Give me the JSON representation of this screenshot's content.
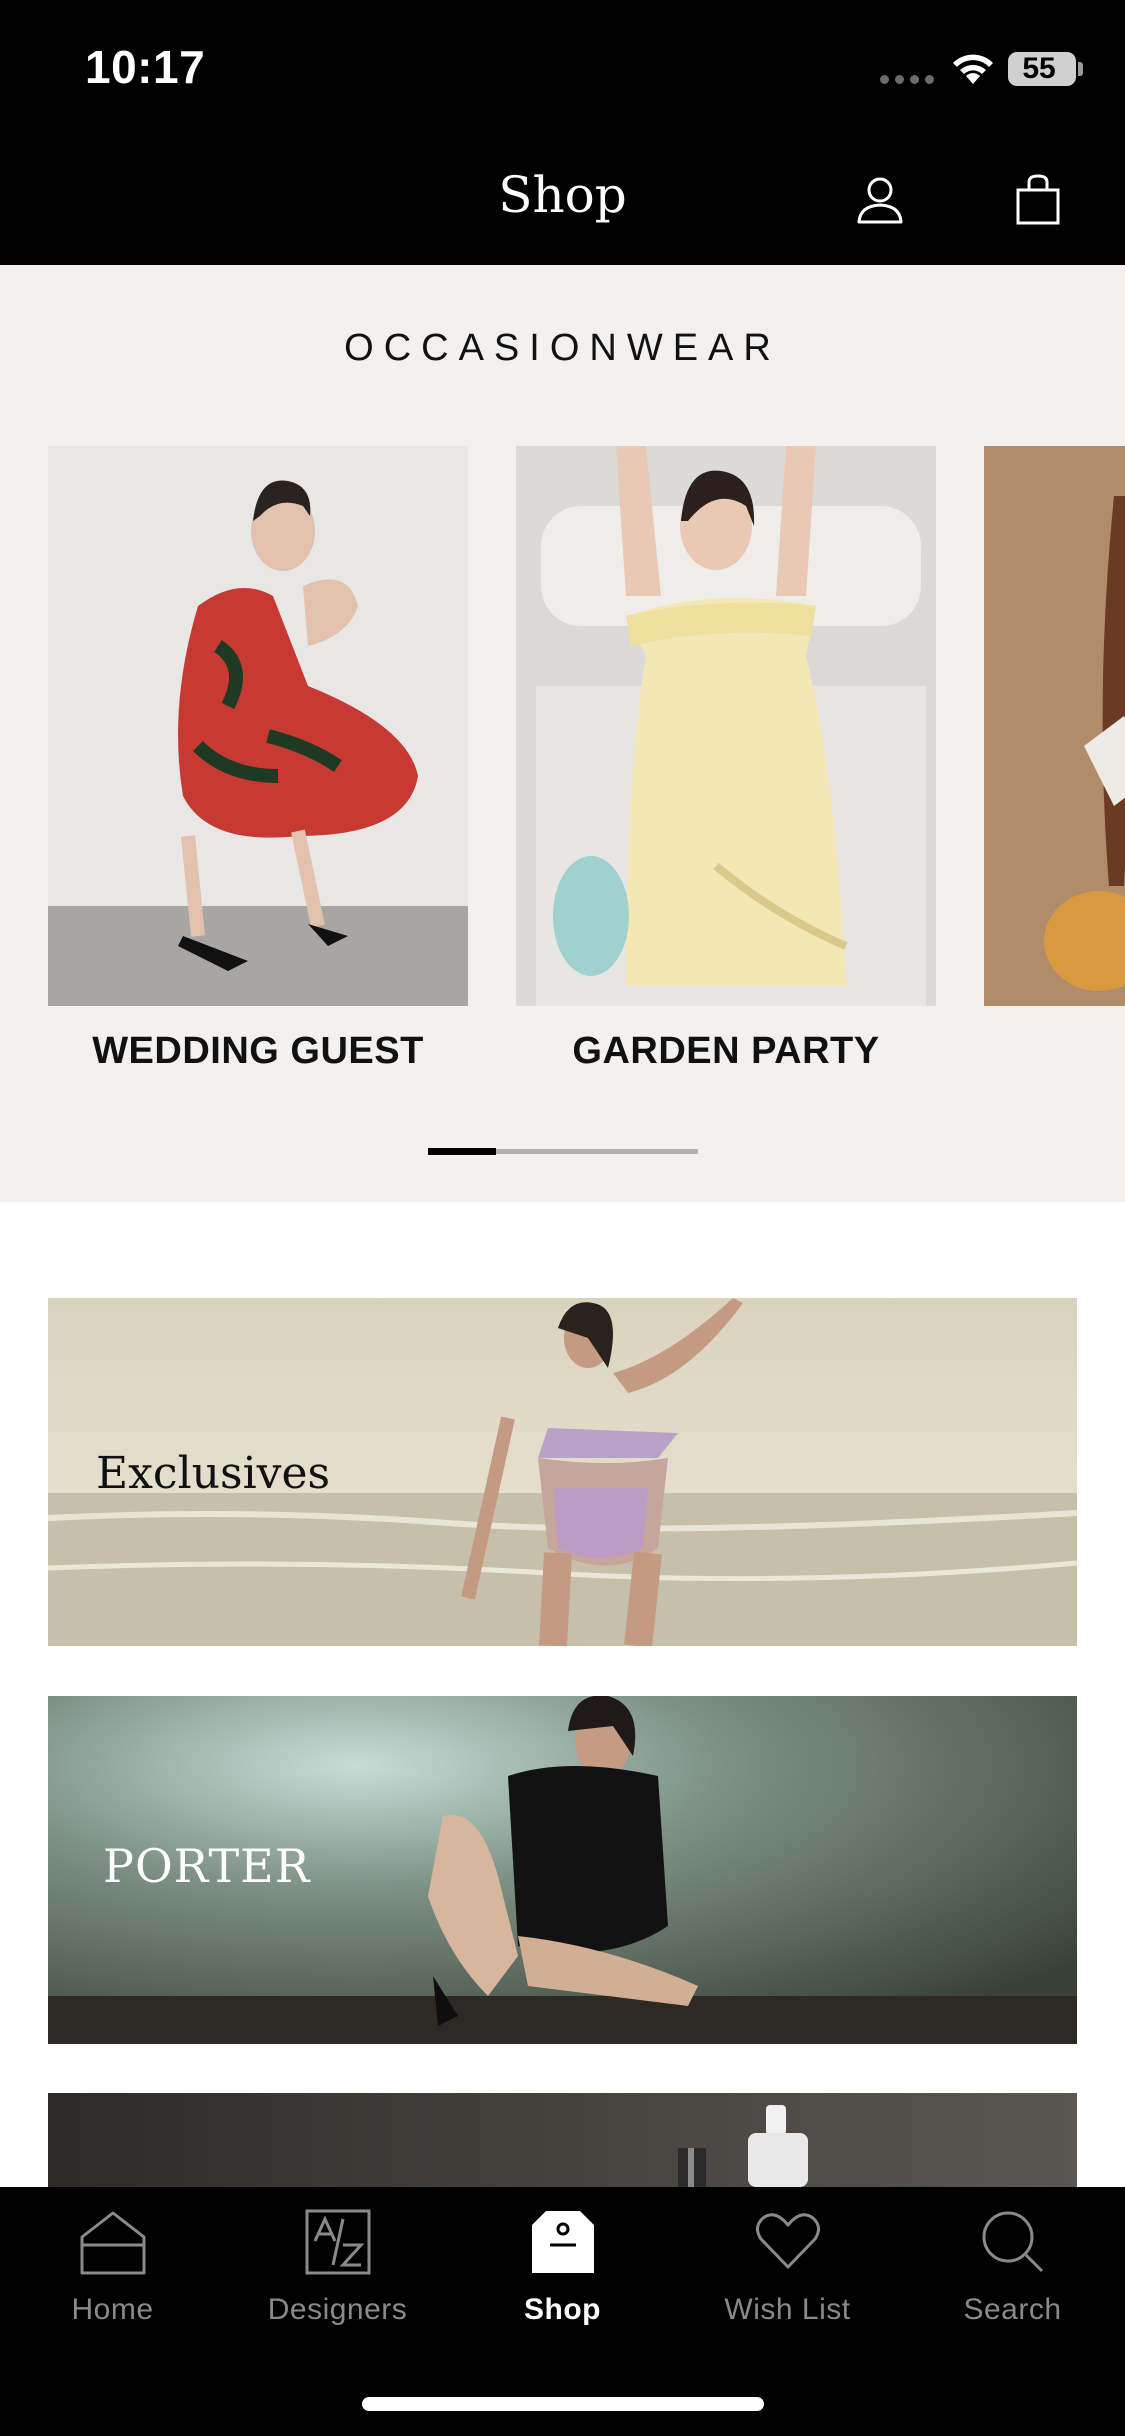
{
  "status": {
    "time": "10:17",
    "battery": "55"
  },
  "header": {
    "title": "Shop"
  },
  "occasionwear": {
    "title": "OCCASIONWEAR",
    "cards": [
      {
        "label": "WEDDING GUEST"
      },
      {
        "label": "GARDEN PARTY"
      },
      {
        "label": ""
      }
    ],
    "carousel_position": 0.25
  },
  "banners": [
    {
      "label": "Exclusives"
    },
    {
      "label": "PORTER"
    },
    {
      "label": ""
    }
  ],
  "tabs": [
    {
      "label": "Home",
      "icon": "home-icon"
    },
    {
      "label": "Designers",
      "icon": "designers-az-icon"
    },
    {
      "label": "Shop",
      "icon": "shop-bag-icon",
      "active": true
    },
    {
      "label": "Wish List",
      "icon": "heart-icon"
    },
    {
      "label": "Search",
      "icon": "search-icon"
    }
  ],
  "colors": {
    "bar": "#000000",
    "section_bg": "#f2f1ef",
    "inactive_tab": "#8a8a8a"
  }
}
